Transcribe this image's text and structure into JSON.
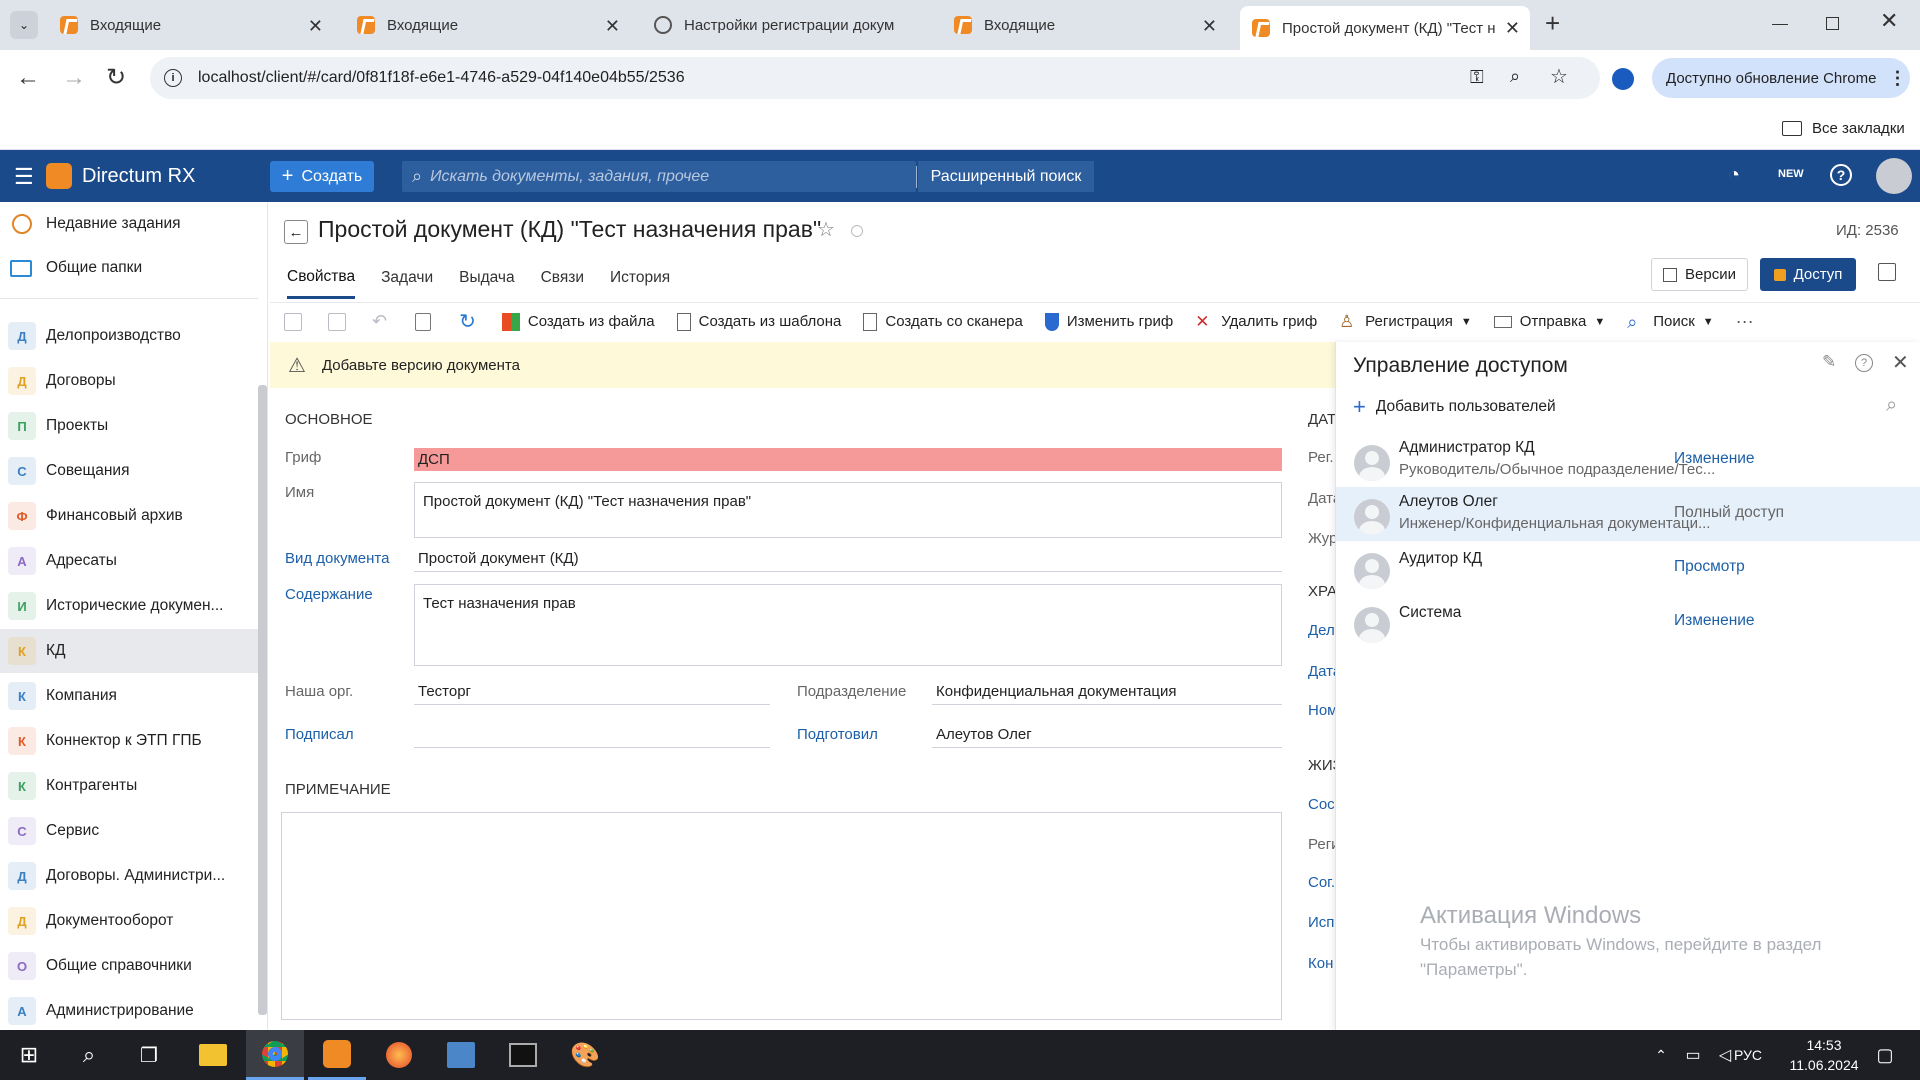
{
  "browser": {
    "tabs": [
      {
        "label": "Входящие"
      },
      {
        "label": "Входящие"
      },
      {
        "label": "Настройки регистрации докум"
      },
      {
        "label": "Входящие"
      },
      {
        "label": "Простой документ (КД) \"Тест н"
      }
    ],
    "url": "localhost/client/#/card/0f81f18f-e6e1-4746-a529-04f140e04b55/2536",
    "update_label": "Доступно обновление Chrome",
    "bookmarks_label": "Все закладки"
  },
  "app": {
    "name": "Directum RX",
    "create_label": "Создать",
    "search_placeholder": "Искать документы, задания, прочее",
    "advanced_search": "Расширенный поиск"
  },
  "sidebar": {
    "top": [
      {
        "label": "Недавние задания"
      },
      {
        "label": "Общие папки"
      }
    ],
    "items": [
      {
        "letter": "Д",
        "label": "Делопроизводство",
        "color": "#3a7ec4"
      },
      {
        "letter": "Д",
        "label": "Договоры",
        "color": "#e0a020"
      },
      {
        "letter": "П",
        "label": "Проекты",
        "color": "#3aa060"
      },
      {
        "letter": "С",
        "label": "Совещания",
        "color": "#3a7ec4"
      },
      {
        "letter": "Ф",
        "label": "Финансовый архив",
        "color": "#e05a2a"
      },
      {
        "letter": "А",
        "label": "Адресаты",
        "color": "#8a6ac4"
      },
      {
        "letter": "И",
        "label": "Исторические докумен...",
        "color": "#3aa060"
      },
      {
        "letter": "К",
        "label": "КД",
        "color": "#e0a020"
      },
      {
        "letter": "К",
        "label": "Компания",
        "color": "#3a7ec4"
      },
      {
        "letter": "К",
        "label": "Коннектор к ЭТП ГПБ",
        "color": "#e05a2a"
      },
      {
        "letter": "К",
        "label": "Контрагенты",
        "color": "#3aa060"
      },
      {
        "letter": "С",
        "label": "Сервис",
        "color": "#8a6ac4"
      },
      {
        "letter": "Д",
        "label": "Договоры. Администри...",
        "color": "#3a7ec4"
      },
      {
        "letter": "Д",
        "label": "Документооборот",
        "color": "#e0a020"
      },
      {
        "letter": "О",
        "label": "Общие справочники",
        "color": "#8a6ac4"
      },
      {
        "letter": "А",
        "label": "Администрирование",
        "color": "#3a7ec4"
      }
    ]
  },
  "card": {
    "title": "Простой документ (КД) \"Тест назначения прав\"",
    "id_label": "ИД: 2536",
    "tabs": [
      "Свойства",
      "Задачи",
      "Выдача",
      "Связи",
      "История"
    ],
    "versions_label": "Версии",
    "access_label": "Доступ",
    "toolbar": [
      "Создать из файла",
      "Создать из шаблона",
      "Создать со сканера",
      "Изменить гриф",
      "Удалить гриф",
      "Регистрация",
      "Отправка",
      "Поиск"
    ],
    "warning": "Добавьте версию документа",
    "section_main": "ОСНОВНОЕ",
    "grif_label": "Гриф",
    "grif_value": "ДСП",
    "name_label": "Имя",
    "name_value": "Простой документ (КД) \"Тест назначения прав\"",
    "doctype_label": "Вид документа",
    "doctype_value": "Простой документ (КД)",
    "content_label": "Содержание",
    "content_value": "Тест назначения прав",
    "org_label": "Наша орг.",
    "org_value": "Тесторг",
    "dept_label": "Подразделение",
    "dept_value": "Конфиденциальная документация",
    "signed_label": "Подписал",
    "prepared_label": "Подготовил",
    "prepared_value": "Алеутов Олег",
    "section_note": "ПРИМЕЧАНИЕ",
    "right_col": [
      "ДАТ",
      "Рег.",
      "Дата",
      "Жур",
      "ХРА",
      "Дел",
      "Дата",
      "Ном",
      "ЖИЗ",
      "Сос",
      "Реги",
      "Сог.",
      "Исп",
      "Кон"
    ]
  },
  "access_panel": {
    "title": "Управление доступом",
    "add_label": "Добавить пользователей",
    "entries": [
      {
        "name": "Администратор КД",
        "sub": "Руководитель/Обычное подразделение/Тес...",
        "right": "Изменение",
        "selected": false
      },
      {
        "name": "Алеутов Олег",
        "sub": "Инженер/Конфиденциальная документаци...",
        "right": "Полный доступ",
        "selected": true
      },
      {
        "name": "Аудитор КД",
        "sub": "",
        "right": "Просмотр",
        "selected": false
      },
      {
        "name": "Система",
        "sub": "",
        "right": "Изменение",
        "selected": false
      }
    ]
  },
  "watermark": {
    "title": "Активация Windows",
    "line1": "Чтобы активировать Windows, перейдите в раздел",
    "line2": "\"Параметры\"."
  },
  "taskbar": {
    "lang": "РУС",
    "time": "14:53",
    "date": "11.06.2024"
  }
}
